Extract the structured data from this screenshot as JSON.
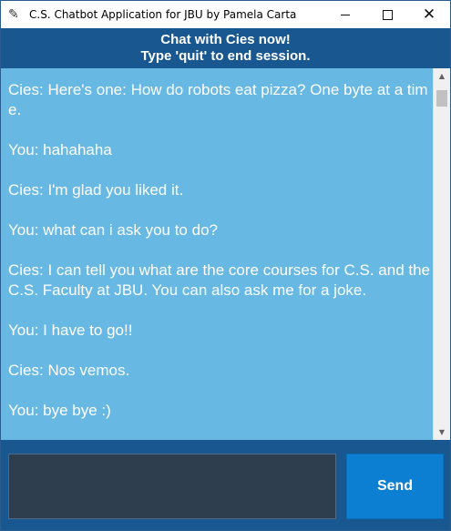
{
  "window": {
    "title": "C.S. Chatbot Application for JBU by Pamela Carta",
    "icon": "feather-icon"
  },
  "header": {
    "line1": "Chat with Cies now!",
    "line2": "Type 'quit' to end session."
  },
  "messages": [
    {
      "text": "Cies: Here's one: How do robots eat pizza? One byte at a time."
    },
    {
      "text": "You: hahahaha"
    },
    {
      "text": "Cies: I'm glad you liked it."
    },
    {
      "text": "You: what can i ask you to do?"
    },
    {
      "text": "Cies: I can tell you what are the core courses for C.S. and the C.S. Faculty at JBU. You can also ask me for a joke."
    },
    {
      "text": "You: I have to go!!"
    },
    {
      "text": "Cies: Nos vemos."
    },
    {
      "text": "You: bye bye :)"
    }
  ],
  "input": {
    "value": ""
  },
  "send_label": "Send",
  "colors": {
    "header_bg": "#18578f",
    "chat_bg": "#67b8e3",
    "input_bg": "#2f3e4f",
    "send_bg": "#0c7fd2"
  }
}
